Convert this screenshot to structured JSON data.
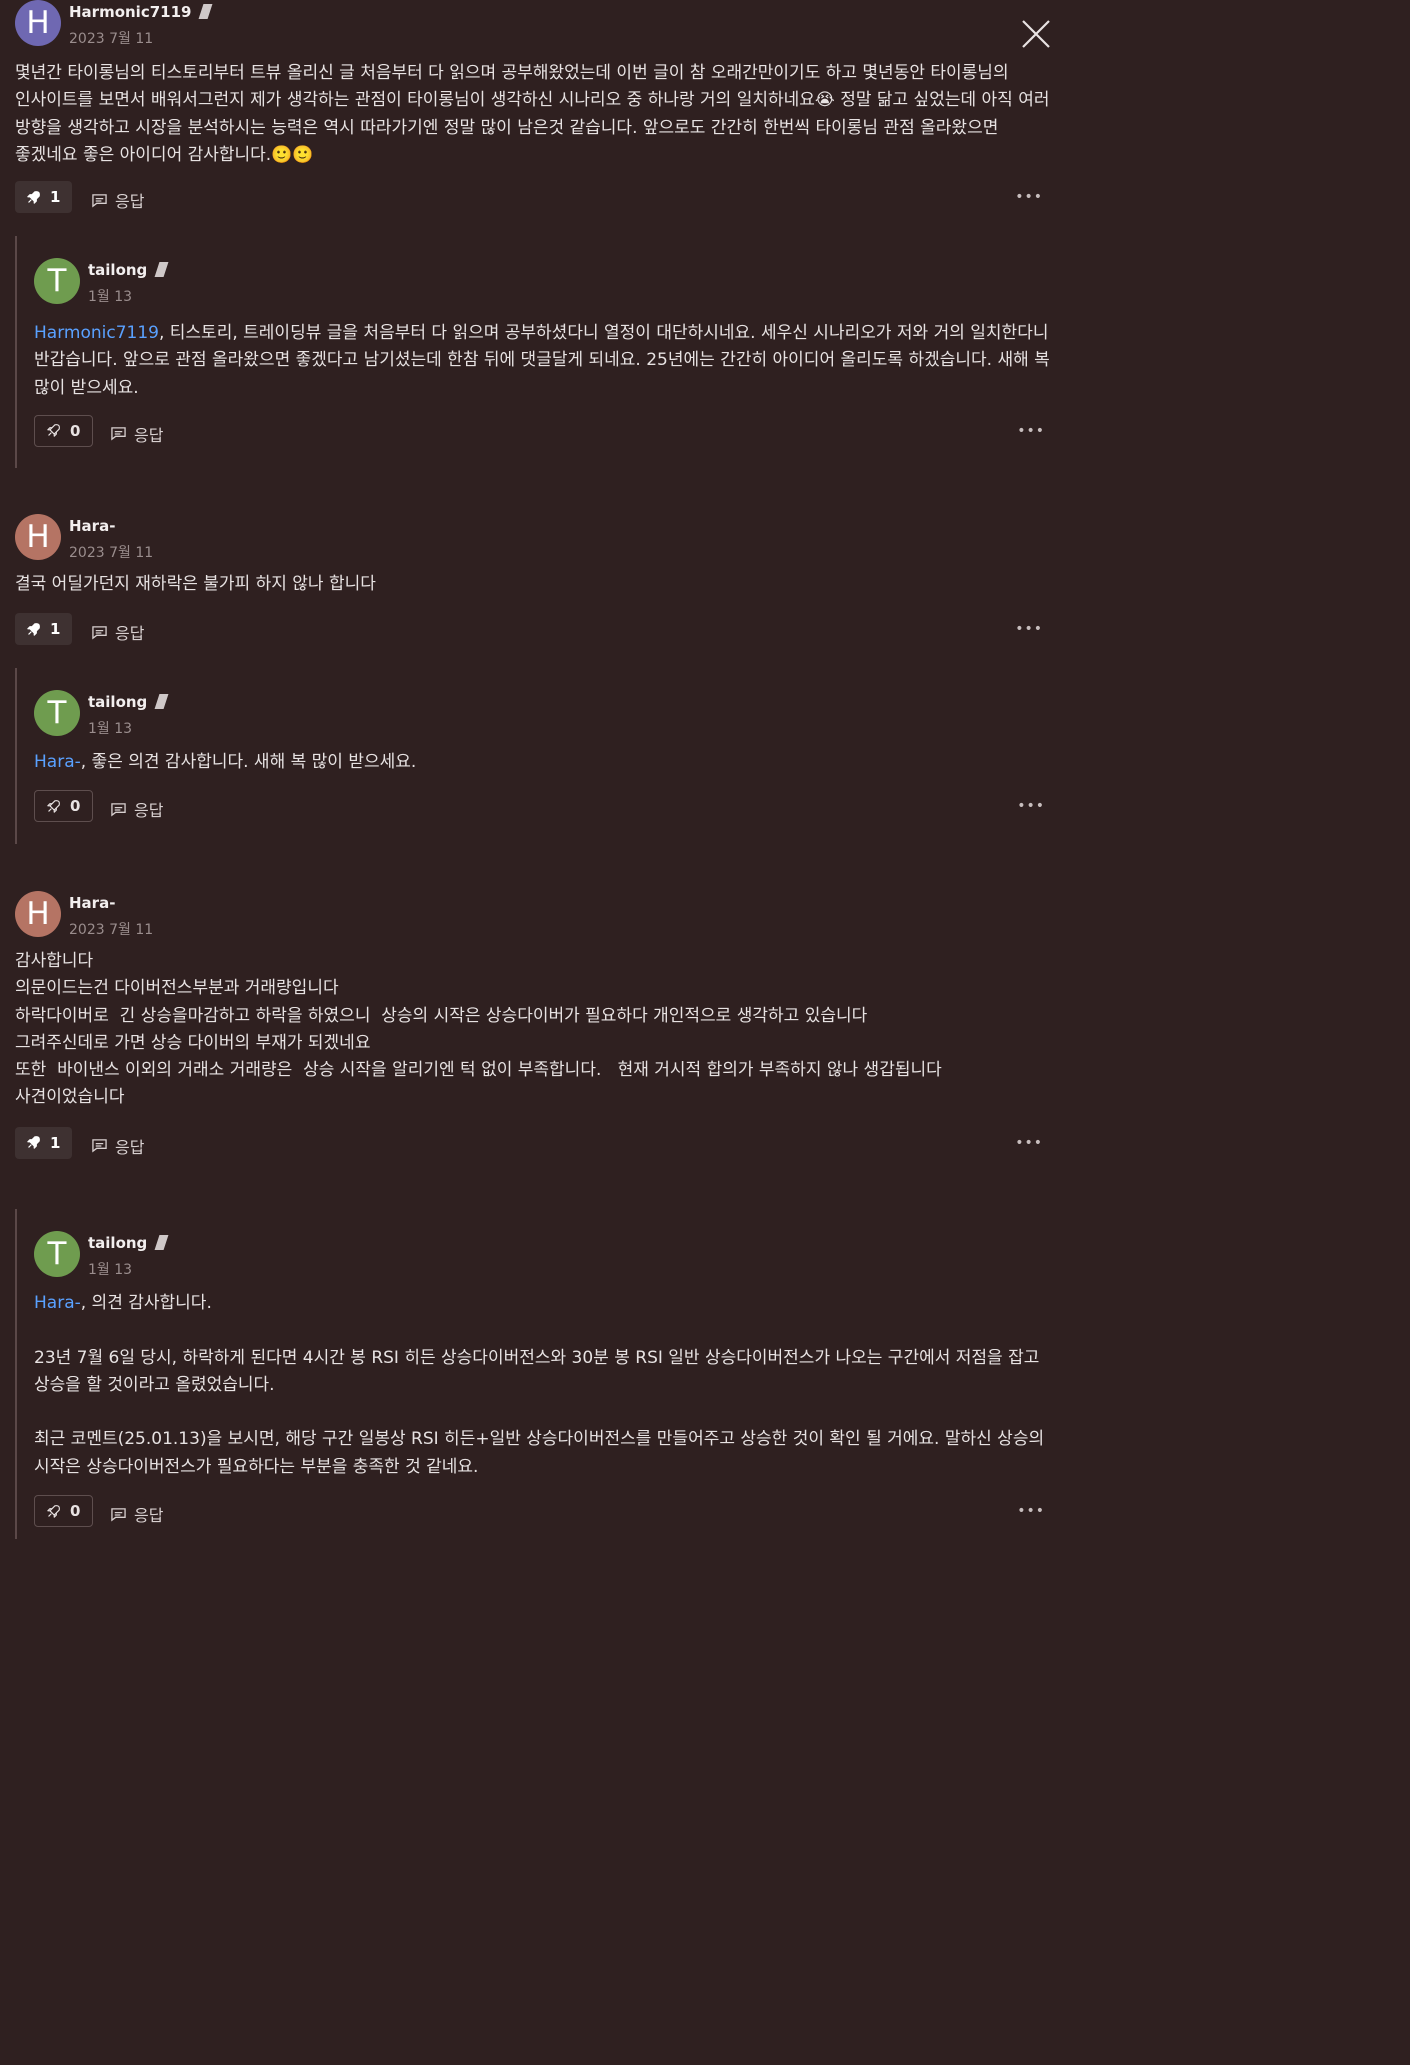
{
  "ui": {
    "reply_label": "응답",
    "more_glyph": "•••"
  },
  "comments": [
    {
      "avatar_letter": "H",
      "avatar_color": "#6f68b2",
      "author": "Harmonic7119",
      "date": "2023 7월 11",
      "body": "몇년간 타이롱님의 티스토리부터 트뷰 올리신 글 처음부터 다 읽으며 공부해왔었는데 이번 글이 참 오래간만이기도 하고 몇년동안 타이롱님의 인사이트를 보면서 배워서그런지 제가 생각하는 관점이 타이롱님이 생각하신 시나리오 중 하나랑 거의 일치하네요😭 정말 닮고 싶었는데 아직 여러 방향을 생각하고 시장을 분석하시는 능력은 역시 따라가기엔 정말 많이 남은것 같습니다. 앞으로도 간간히 한번씩 타이롱님 관점 올라왔으면 좋겠네요 좋은 아이디어 감사합니다.🙂🙂",
      "boosts": "1",
      "reply": {
        "avatar_letter": "T",
        "avatar_color": "#6f9c4f",
        "author": "tailong",
        "date": "1월 13",
        "mention": "Harmonic7119",
        "body": ", 티스토리, 트레이딩뷰 글을 처음부터 다 읽으며 공부하셨다니 열정이 대단하시네요. 세우신 시나리오가 저와 거의 일치한다니 반갑습니다. 앞으로 관점 올라왔으면 좋겠다고 남기셨는데 한참 뒤에 댓글달게 되네요. 25년에는 간간히 아이디어 올리도록 하겠습니다. 새해 복 많이 받으세요.",
        "boosts": "0"
      }
    },
    {
      "avatar_letter": "H",
      "avatar_color": "#b57464",
      "author": "Hara-",
      "date": "2023 7월 11",
      "body": "결국 어딜가던지 재하락은 불가피 하지 않나 합니다",
      "boosts": "1",
      "reply": {
        "avatar_letter": "T",
        "avatar_color": "#6f9c4f",
        "author": "tailong",
        "date": "1월 13",
        "mention": "Hara-",
        "body": ", 좋은 의견 감사합니다. 새해 복 많이 받으세요.",
        "boosts": "0"
      }
    },
    {
      "avatar_letter": "H",
      "avatar_color": "#b57464",
      "author": "Hara-",
      "date": "2023 7월 11",
      "body": "감사합니다\n의문이드는건 다이버전스부분과 거래량입니다\n하락다이버로  긴 상승을마감하고 하락을 하였으니  상승의 시작은 상승다이버가 필요하다 개인적으로 생각하고 있습니다\n그려주신데로 가면 상승 다이버의 부재가 되겠네요\n또한  바이낸스 이외의 거래소 거래량은  상승 시작을 알리기엔 턱 없이 부족합니다.   현재 거시적 합의가 부족하지 않나 생갑됩니다\n사견이었습니다",
      "boosts": "1",
      "reply": {
        "avatar_letter": "T",
        "avatar_color": "#6f9c4f",
        "author": "tailong",
        "date": "1월 13",
        "mention": "Hara-",
        "body": ", 의견 감사합니다.\n\n23년 7월 6일 당시, 하락하게 된다면 4시간 봉 RSI 히든 상승다이버전스와 30분 봉 RSI 일반 상승다이버전스가 나오는 구간에서 저점을 잡고 상승을 할 것이라고 올렸었습니다.\n\n최근 코멘트(25.01.13)을 보시면, 해당 구간 일봉상 RSI 히든+일반 상승다이버전스를 만들어주고 상승한 것이 확인 될 거에요. 말하신 상승의 시작은 상승다이버전스가 필요하다는 부분을 충족한 것 같네요.",
        "boosts": "0"
      }
    }
  ]
}
